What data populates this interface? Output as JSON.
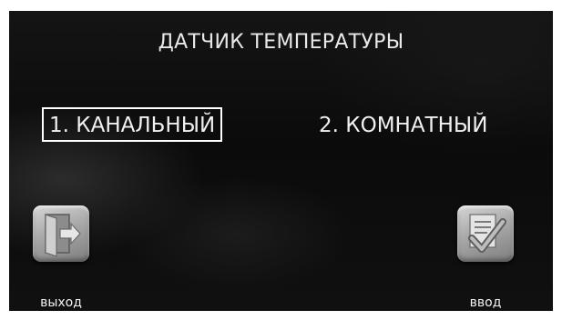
{
  "screen": {
    "title": "ДАТЧИК ТЕМПЕРАТУРЫ"
  },
  "options": [
    {
      "label": "1. КАНАЛЬНЫЙ",
      "selected": true
    },
    {
      "label": "2. КОМНАТНЫЙ",
      "selected": false
    }
  ],
  "buttons": {
    "exit_label": "выход",
    "exit_icon": "exit-door-icon",
    "enter_label": "ввод",
    "enter_icon": "checkmark-document-icon"
  },
  "colors": {
    "background": "#0b0b0b",
    "text": "#f0f0f0",
    "selection_border": "#ffffff",
    "button_face": "#a9a9a9"
  }
}
